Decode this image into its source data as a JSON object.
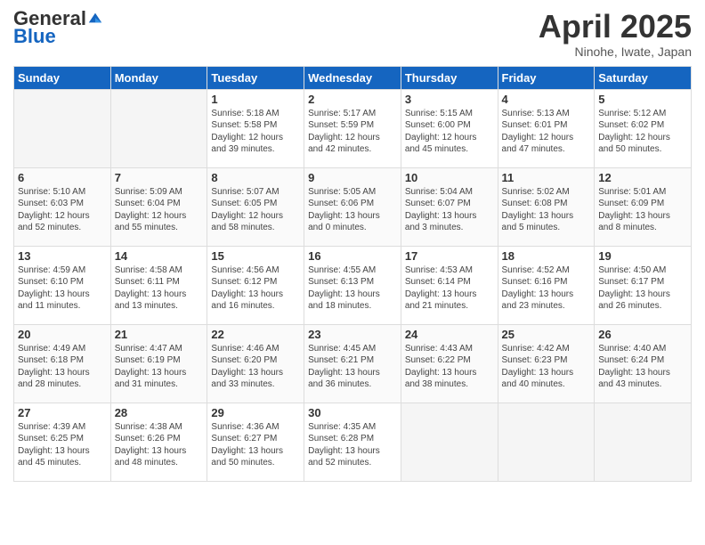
{
  "header": {
    "logo_general": "General",
    "logo_blue": "Blue",
    "title": "April 2025",
    "location": "Ninohe, Iwate, Japan"
  },
  "weekdays": [
    "Sunday",
    "Monday",
    "Tuesday",
    "Wednesday",
    "Thursday",
    "Friday",
    "Saturday"
  ],
  "weeks": [
    [
      {
        "day": "",
        "empty": true
      },
      {
        "day": "",
        "empty": true
      },
      {
        "day": "1",
        "sunrise": "Sunrise: 5:18 AM",
        "sunset": "Sunset: 5:58 PM",
        "daylight": "Daylight: 12 hours and 39 minutes."
      },
      {
        "day": "2",
        "sunrise": "Sunrise: 5:17 AM",
        "sunset": "Sunset: 5:59 PM",
        "daylight": "Daylight: 12 hours and 42 minutes."
      },
      {
        "day": "3",
        "sunrise": "Sunrise: 5:15 AM",
        "sunset": "Sunset: 6:00 PM",
        "daylight": "Daylight: 12 hours and 45 minutes."
      },
      {
        "day": "4",
        "sunrise": "Sunrise: 5:13 AM",
        "sunset": "Sunset: 6:01 PM",
        "daylight": "Daylight: 12 hours and 47 minutes."
      },
      {
        "day": "5",
        "sunrise": "Sunrise: 5:12 AM",
        "sunset": "Sunset: 6:02 PM",
        "daylight": "Daylight: 12 hours and 50 minutes."
      }
    ],
    [
      {
        "day": "6",
        "sunrise": "Sunrise: 5:10 AM",
        "sunset": "Sunset: 6:03 PM",
        "daylight": "Daylight: 12 hours and 52 minutes."
      },
      {
        "day": "7",
        "sunrise": "Sunrise: 5:09 AM",
        "sunset": "Sunset: 6:04 PM",
        "daylight": "Daylight: 12 hours and 55 minutes."
      },
      {
        "day": "8",
        "sunrise": "Sunrise: 5:07 AM",
        "sunset": "Sunset: 6:05 PM",
        "daylight": "Daylight: 12 hours and 58 minutes."
      },
      {
        "day": "9",
        "sunrise": "Sunrise: 5:05 AM",
        "sunset": "Sunset: 6:06 PM",
        "daylight": "Daylight: 13 hours and 0 minutes."
      },
      {
        "day": "10",
        "sunrise": "Sunrise: 5:04 AM",
        "sunset": "Sunset: 6:07 PM",
        "daylight": "Daylight: 13 hours and 3 minutes."
      },
      {
        "day": "11",
        "sunrise": "Sunrise: 5:02 AM",
        "sunset": "Sunset: 6:08 PM",
        "daylight": "Daylight: 13 hours and 5 minutes."
      },
      {
        "day": "12",
        "sunrise": "Sunrise: 5:01 AM",
        "sunset": "Sunset: 6:09 PM",
        "daylight": "Daylight: 13 hours and 8 minutes."
      }
    ],
    [
      {
        "day": "13",
        "sunrise": "Sunrise: 4:59 AM",
        "sunset": "Sunset: 6:10 PM",
        "daylight": "Daylight: 13 hours and 11 minutes."
      },
      {
        "day": "14",
        "sunrise": "Sunrise: 4:58 AM",
        "sunset": "Sunset: 6:11 PM",
        "daylight": "Daylight: 13 hours and 13 minutes."
      },
      {
        "day": "15",
        "sunrise": "Sunrise: 4:56 AM",
        "sunset": "Sunset: 6:12 PM",
        "daylight": "Daylight: 13 hours and 16 minutes."
      },
      {
        "day": "16",
        "sunrise": "Sunrise: 4:55 AM",
        "sunset": "Sunset: 6:13 PM",
        "daylight": "Daylight: 13 hours and 18 minutes."
      },
      {
        "day": "17",
        "sunrise": "Sunrise: 4:53 AM",
        "sunset": "Sunset: 6:14 PM",
        "daylight": "Daylight: 13 hours and 21 minutes."
      },
      {
        "day": "18",
        "sunrise": "Sunrise: 4:52 AM",
        "sunset": "Sunset: 6:16 PM",
        "daylight": "Daylight: 13 hours and 23 minutes."
      },
      {
        "day": "19",
        "sunrise": "Sunrise: 4:50 AM",
        "sunset": "Sunset: 6:17 PM",
        "daylight": "Daylight: 13 hours and 26 minutes."
      }
    ],
    [
      {
        "day": "20",
        "sunrise": "Sunrise: 4:49 AM",
        "sunset": "Sunset: 6:18 PM",
        "daylight": "Daylight: 13 hours and 28 minutes."
      },
      {
        "day": "21",
        "sunrise": "Sunrise: 4:47 AM",
        "sunset": "Sunset: 6:19 PM",
        "daylight": "Daylight: 13 hours and 31 minutes."
      },
      {
        "day": "22",
        "sunrise": "Sunrise: 4:46 AM",
        "sunset": "Sunset: 6:20 PM",
        "daylight": "Daylight: 13 hours and 33 minutes."
      },
      {
        "day": "23",
        "sunrise": "Sunrise: 4:45 AM",
        "sunset": "Sunset: 6:21 PM",
        "daylight": "Daylight: 13 hours and 36 minutes."
      },
      {
        "day": "24",
        "sunrise": "Sunrise: 4:43 AM",
        "sunset": "Sunset: 6:22 PM",
        "daylight": "Daylight: 13 hours and 38 minutes."
      },
      {
        "day": "25",
        "sunrise": "Sunrise: 4:42 AM",
        "sunset": "Sunset: 6:23 PM",
        "daylight": "Daylight: 13 hours and 40 minutes."
      },
      {
        "day": "26",
        "sunrise": "Sunrise: 4:40 AM",
        "sunset": "Sunset: 6:24 PM",
        "daylight": "Daylight: 13 hours and 43 minutes."
      }
    ],
    [
      {
        "day": "27",
        "sunrise": "Sunrise: 4:39 AM",
        "sunset": "Sunset: 6:25 PM",
        "daylight": "Daylight: 13 hours and 45 minutes."
      },
      {
        "day": "28",
        "sunrise": "Sunrise: 4:38 AM",
        "sunset": "Sunset: 6:26 PM",
        "daylight": "Daylight: 13 hours and 48 minutes."
      },
      {
        "day": "29",
        "sunrise": "Sunrise: 4:36 AM",
        "sunset": "Sunset: 6:27 PM",
        "daylight": "Daylight: 13 hours and 50 minutes."
      },
      {
        "day": "30",
        "sunrise": "Sunrise: 4:35 AM",
        "sunset": "Sunset: 6:28 PM",
        "daylight": "Daylight: 13 hours and 52 minutes."
      },
      {
        "day": "",
        "empty": true
      },
      {
        "day": "",
        "empty": true
      },
      {
        "day": "",
        "empty": true
      }
    ]
  ]
}
